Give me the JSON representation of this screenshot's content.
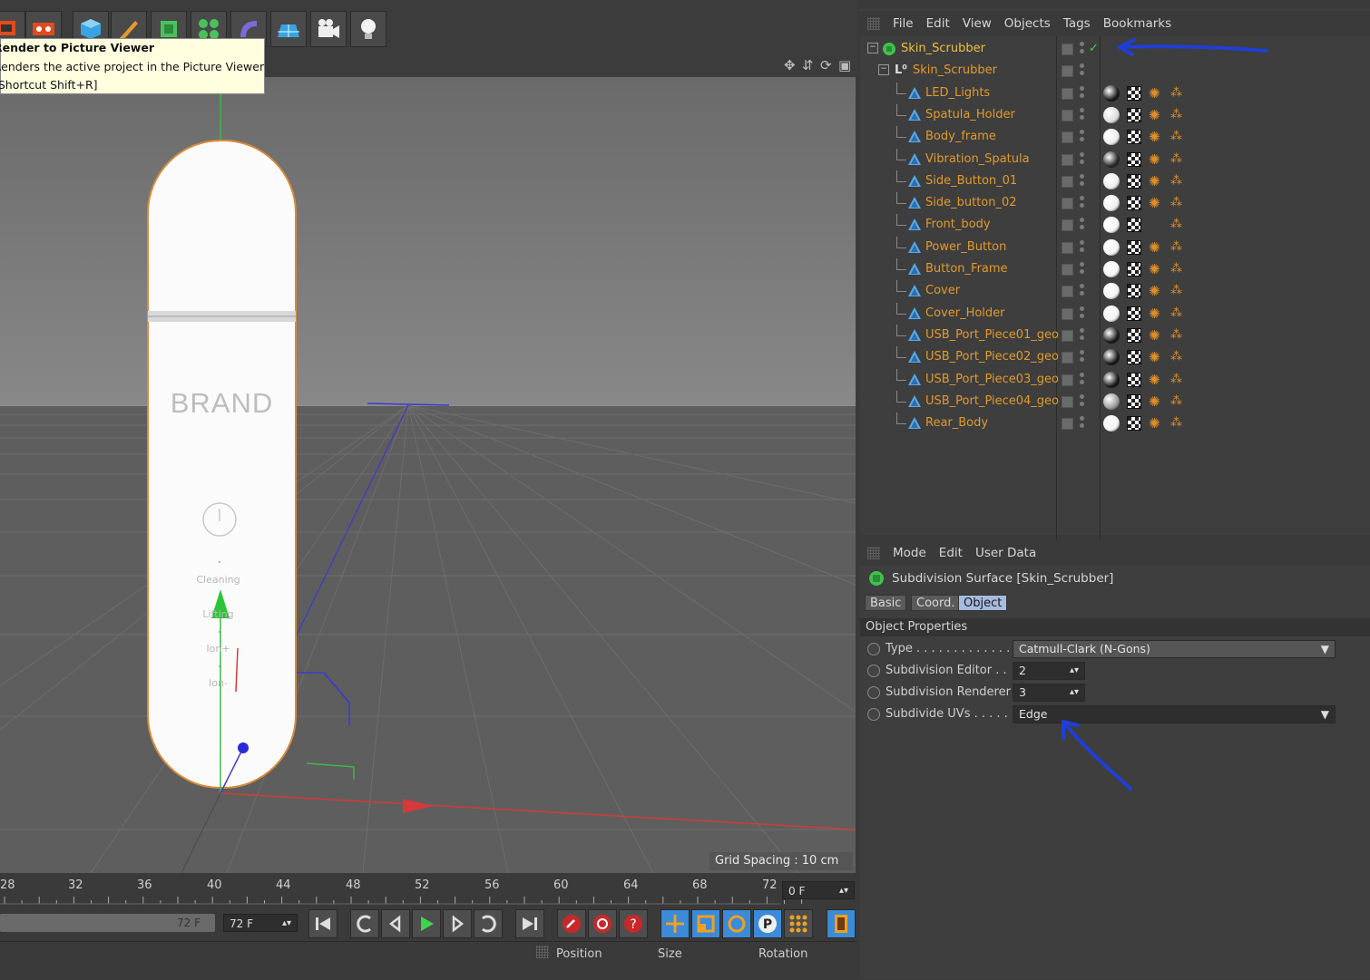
{
  "tooltip": {
    "title": "Render to Picture Viewer",
    "description": "Renders the active project in the Picture Viewer",
    "shortcut": "[Shortcut Shift+R]"
  },
  "toolbar": {
    "icons": [
      "render-region-icon",
      "render-settings-icon",
      "cube-icon",
      "pen-icon",
      "subdivision-icon",
      "array-icon",
      "deformer-icon",
      "floor-icon",
      "camera-icon",
      "light-icon"
    ]
  },
  "viewport": {
    "grid_spacing": "Grid Spacing : 10 cm",
    "model": {
      "brand": "BRAND",
      "label_cleaning": "Cleaning",
      "label_lifting": "Lifting",
      "label_ion1": "Ion+",
      "label_ion2": "Ion-"
    }
  },
  "timeline": {
    "ticks": [
      "28",
      "32",
      "36",
      "40",
      "44",
      "48",
      "52",
      "56",
      "60",
      "64",
      "68",
      "72"
    ],
    "current_frame": "0 F",
    "slider_value": "72 F",
    "end_frame": "72 F"
  },
  "coords": {
    "position": "Position",
    "size": "Size",
    "rotation": "Rotation"
  },
  "object_manager": {
    "menu": [
      "File",
      "Edit",
      "View",
      "Objects",
      "Tags",
      "Bookmarks"
    ],
    "root": "Skin_Scrubber",
    "null": "Skin_Scrubber",
    "children": [
      {
        "name": "LED_Lights",
        "mat": "#1a1a1a"
      },
      {
        "name": "Spatula_Holder",
        "mat": "#dddddd"
      },
      {
        "name": "Body_frame",
        "mat": "#eeeeee"
      },
      {
        "name": "Vibration_Spatula",
        "mat": "#2a2a2a"
      },
      {
        "name": "Side_Button_01",
        "mat": "#eeeeee"
      },
      {
        "name": "Side_button_02",
        "mat": "#eeeeee"
      },
      {
        "name": "Front_body",
        "mat": "#f4f4f4"
      },
      {
        "name": "Power_Button",
        "mat": "#f4f4f4"
      },
      {
        "name": "Button_Frame",
        "mat": "#f4f4f4"
      },
      {
        "name": "Cover",
        "mat": "#f4f4f4"
      },
      {
        "name": "Cover_Holder",
        "mat": "#f4f4f4"
      },
      {
        "name": "USB_Port_Piece01_geo",
        "mat": "#1a1a1a"
      },
      {
        "name": "USB_Port_Piece02_geo",
        "mat": "#1a1a1a"
      },
      {
        "name": "USB_Port_Piece03_geo",
        "mat": "#1a1a1a"
      },
      {
        "name": "USB_Port_Piece04_geo",
        "mat": "#9a9a9a"
      },
      {
        "name": "Rear_Body",
        "mat": "#f4f4f4"
      }
    ]
  },
  "attribute_manager": {
    "menu": [
      "Mode",
      "Edit",
      "User Data"
    ],
    "title": "Subdivision Surface [Skin_Scrubber]",
    "tabs": [
      "Basic",
      "Coord.",
      "Object"
    ],
    "active_tab": "Object",
    "section": "Object Properties",
    "props": {
      "type_label": "Type . . . . . . . . . . . . . .",
      "type_value": "Catmull-Clark (N-Gons)",
      "editor_label": "Subdivision Editor . .",
      "editor_value": "2",
      "renderer_label": "Subdivision Renderer",
      "renderer_value": "3",
      "uvs_label": "Subdivide UVs . . . . . .",
      "uvs_value": "Edge"
    }
  },
  "colors": {
    "accent_orange": "#e29a2b",
    "selection_blue": "#a7bbe0",
    "annotation_arrow": "#1f3fd6"
  }
}
